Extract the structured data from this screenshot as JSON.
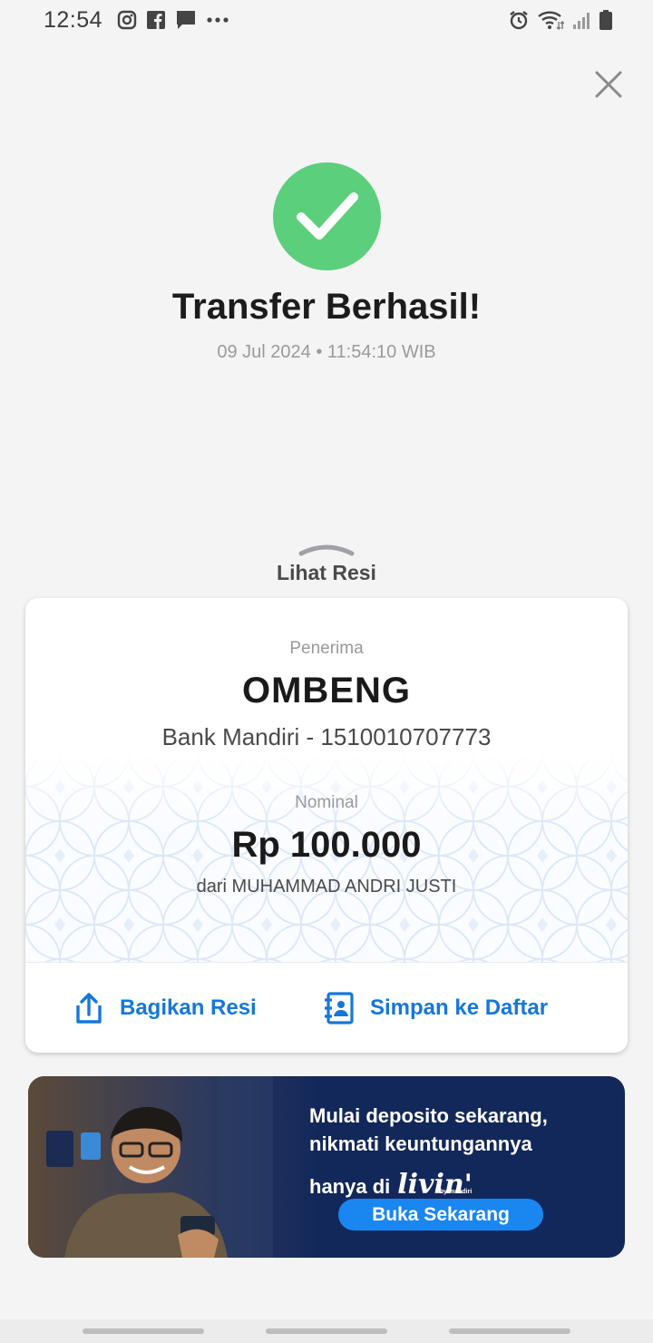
{
  "status_bar": {
    "time": "12:54",
    "left_icons": [
      "instagram-icon",
      "facebook-icon",
      "message-icon",
      "more-dots-icon"
    ],
    "right_icons": [
      "alarm-icon",
      "wifi-icon",
      "signal-icon",
      "battery-icon"
    ]
  },
  "success": {
    "title": "Transfer Berhasil!",
    "datetime": "09 Jul 2024 • 11:54:10 WIB",
    "color": "#5ccf7c"
  },
  "receipt_toggle": {
    "label": "Lihat Resi"
  },
  "receipt": {
    "recipient_label": "Penerima",
    "recipient_name": "OMBENG",
    "recipient_account": "Bank Mandiri - 1510010707773",
    "amount_label": "Nominal",
    "amount": "Rp 100.000",
    "sender": "dari MUHAMMAD ANDRI JUSTI"
  },
  "actions": {
    "share_label": "Bagikan Resi",
    "save_label": "Simpan ke Daftar",
    "accent": "#1677d8"
  },
  "banner": {
    "line1": "Mulai deposito sekarang,",
    "line2": "nikmati keuntungannya",
    "line3": "hanya di",
    "logo": "livin'",
    "logo_sub": "by mandiri",
    "cta": "Buka Sekarang",
    "background": "#13285a",
    "cta_color": "#1a86f0"
  }
}
